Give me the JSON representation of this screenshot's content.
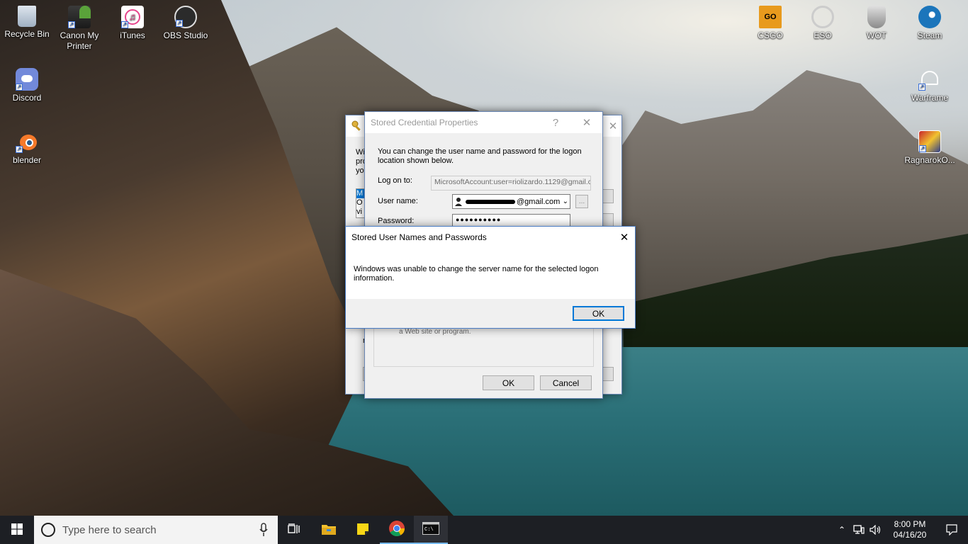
{
  "desktop": {
    "icons_left": [
      {
        "label": "Recycle Bin",
        "icon": "recycle-bin-icon"
      },
      {
        "label": "Canon My Printer",
        "icon": "printer-icon"
      },
      {
        "label": "iTunes",
        "icon": "itunes-icon"
      },
      {
        "label": "OBS Studio",
        "icon": "obs-icon"
      },
      {
        "label": "Discord",
        "icon": "discord-icon"
      },
      {
        "label": "blender",
        "icon": "blender-icon"
      }
    ],
    "icons_right": [
      {
        "label": "CSGO",
        "icon": "csgo-icon",
        "badge": "GO"
      },
      {
        "label": "ESO",
        "icon": "eso-icon"
      },
      {
        "label": "WOT",
        "icon": "wot-icon"
      },
      {
        "label": "Steam",
        "icon": "steam-icon"
      },
      {
        "label": "Warframe",
        "icon": "warframe-icon"
      },
      {
        "label": "RagnarokO...",
        "icon": "ragnarok-icon"
      }
    ]
  },
  "back_window": {
    "partial_lines": [
      "Wi",
      "pro",
      "you"
    ],
    "list_partial": [
      "M",
      "O",
      "vi"
    ],
    "bottom_partial": "r"
  },
  "credential_dialog": {
    "title": "Stored Credential Properties",
    "help_glyph": "?",
    "close_glyph": "✕",
    "intro": "You can change the user name and password for the logon location shown below.",
    "logon_label": "Log on to:",
    "logon_value": "MicrosoftAccount:user=riolizardo.1129@gmail.c",
    "username_label": "User name:",
    "username_value": "@gmail.com",
    "browse_label": "...",
    "password_label": "Password:",
    "password_value": "●●●●●●●●●●",
    "hint_partial": "a Web site or program.",
    "ok_label": "OK",
    "cancel_label": "Cancel"
  },
  "error_dialog": {
    "title": "Stored User Names and Passwords",
    "close_glyph": "✕",
    "message": "Windows was unable to change the server name for the selected logon information.",
    "ok_label": "OK"
  },
  "taskbar": {
    "search_placeholder": "Type here to search",
    "time": "8:00 PM",
    "date": "04/16/20",
    "pinned": [
      "task-view-icon",
      "file-explorer-icon",
      "sticky-notes-icon",
      "chrome-icon",
      "terminal-icon"
    ]
  },
  "colors": {
    "accent": "#0078d7",
    "taskbar": "#1d1f24"
  }
}
